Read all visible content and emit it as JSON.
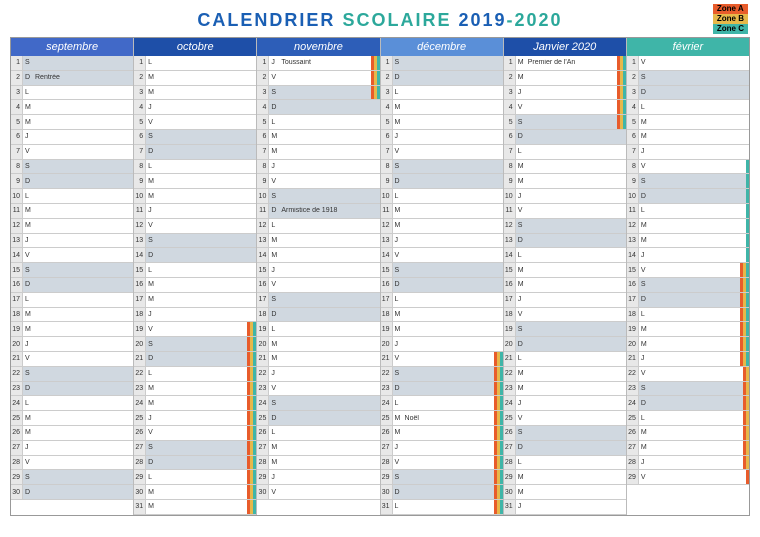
{
  "title": {
    "p1": "CALENDRIER",
    "p2": "SCOLAIRE",
    "p3": "2019",
    "p4": "-2020"
  },
  "legend": {
    "a": "Zone A",
    "b": "Zone B",
    "c": "Zone C"
  },
  "months": [
    {
      "name": "septembre",
      "days": 30,
      "start": 6,
      "cls": "mh0",
      "events": {
        "2": "Rentrée"
      },
      "bars": {}
    },
    {
      "name": "octobre",
      "days": 31,
      "start": 1,
      "cls": "mh1",
      "events": {},
      "bars": {
        "19": "abc",
        "20": "abc",
        "21": "abc",
        "22": "abc",
        "23": "abc",
        "24": "abc",
        "25": "abc",
        "26": "abc",
        "27": "abc",
        "28": "abc",
        "29": "abc",
        "30": "abc",
        "31": "abc"
      }
    },
    {
      "name": "novembre",
      "days": 30,
      "start": 4,
      "cls": "mh2",
      "events": {
        "1": "Toussaint",
        "11": "Armistice de 1918"
      },
      "bars": {
        "1": "abc",
        "2": "abc",
        "3": "abc"
      }
    },
    {
      "name": "décembre",
      "days": 31,
      "start": 6,
      "cls": "mh3",
      "events": {
        "25": "Noël"
      },
      "bars": {
        "21": "abc",
        "22": "abc",
        "23": "abc",
        "24": "abc",
        "25": "abc",
        "26": "abc",
        "27": "abc",
        "28": "abc",
        "29": "abc",
        "30": "abc",
        "31": "abc"
      }
    },
    {
      "name": "Janvier 2020",
      "days": 31,
      "start": 2,
      "cls": "mh4",
      "events": {
        "1": "Premier de l'An"
      },
      "bars": {
        "1": "abc",
        "2": "abc",
        "3": "abc",
        "4": "abc",
        "5": "abc"
      }
    },
    {
      "name": "février",
      "days": 29,
      "start": 5,
      "cls": "mh5",
      "events": {},
      "bars": {
        "8": "c",
        "9": "c",
        "10": "c",
        "11": "c",
        "12": "c",
        "13": "c",
        "14": "c",
        "15": "abc",
        "16": "abc",
        "17": "abc",
        "18": "abc",
        "19": "abc",
        "20": "abc",
        "21": "abc",
        "22": "ab",
        "23": "ab",
        "24": "ab",
        "25": "ab",
        "26": "ab",
        "27": "ab",
        "28": "ab",
        "29": "a"
      }
    }
  ],
  "dow": [
    "L",
    "M",
    "M",
    "J",
    "V",
    "S",
    "D"
  ]
}
